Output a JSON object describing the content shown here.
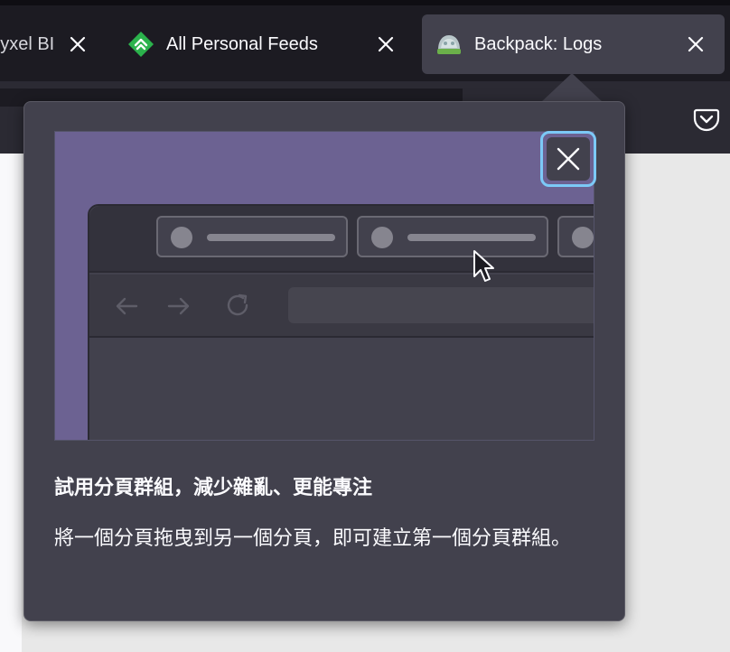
{
  "tabs": [
    {
      "label": "Zyxel BI",
      "selected": false
    },
    {
      "label": "All Personal Feeds",
      "selected": false,
      "icon": "feedly-icon"
    },
    {
      "label": "Backpack: Logs",
      "selected": true,
      "icon": "backpack-icon"
    }
  ],
  "toolbar": {
    "pocket_icon": "pocket-icon"
  },
  "popup": {
    "title": "試用分頁群組，減少雜亂、更能專注",
    "body": "將一個分頁拖曳到另一個分頁，即可建立第一個分頁群組。"
  },
  "colors": {
    "accent_focus": "#7cc9f7",
    "hero_background": "#6c6292",
    "popup_background": "#42414d",
    "feedly_green": "#2bb24c"
  }
}
